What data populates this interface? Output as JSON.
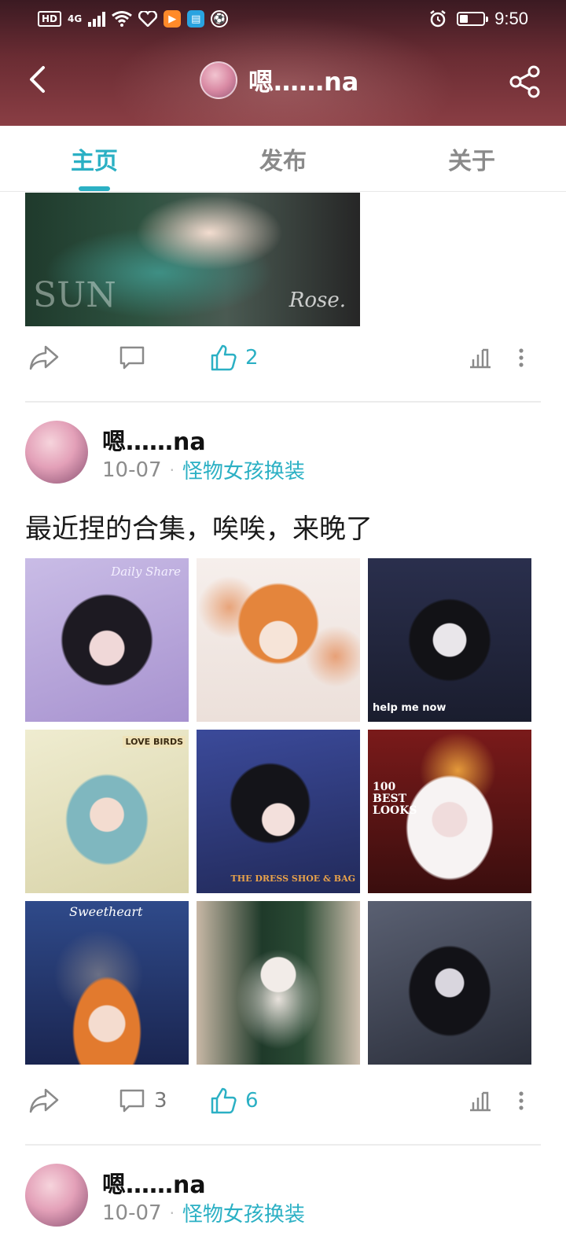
{
  "status_bar": {
    "network": "4G",
    "hd_label": "HD",
    "time": "9:50"
  },
  "header": {
    "profile_name": "嗯……na"
  },
  "tabs": [
    {
      "label": "主页",
      "active": true
    },
    {
      "label": "发布",
      "active": false
    },
    {
      "label": "关于",
      "active": false
    }
  ],
  "top_post": {
    "image_texts": [
      "SUN",
      "Rose."
    ],
    "likes": "2"
  },
  "post": {
    "author": "嗯……na",
    "date": "10-07",
    "topic": "怪物女孩换装",
    "text": "最近捏的合集，唉唉，来晚了",
    "images": [
      {
        "caption": "Daily Share",
        "colors": [
          "#b7a6d8",
          "#2a1f2a"
        ]
      },
      {
        "caption": "",
        "colors": [
          "#f3e7e2",
          "#e59a6a"
        ]
      },
      {
        "caption": "help me now",
        "colors": [
          "#1e2236",
          "#cfd5e5"
        ]
      },
      {
        "caption": "LOVE BIRDS",
        "colors": [
          "#e9e6c6",
          "#6fa7b0"
        ]
      },
      {
        "caption": "THE DRESS SHOE & BAG",
        "colors": [
          "#2f3f85",
          "#121218"
        ]
      },
      {
        "caption": "100 BEST LOOKS",
        "colors": [
          "#6e1616",
          "#f0eaea"
        ]
      },
      {
        "caption": "Sweetheart",
        "colors": [
          "#2a3f7a",
          "#d8783a"
        ]
      },
      {
        "caption": "",
        "colors": [
          "#1f3a2a",
          "#d9cfc2"
        ]
      },
      {
        "caption": "",
        "colors": [
          "#2b2f3e",
          "#9aa2b5"
        ]
      }
    ],
    "comments": "3",
    "likes": "6"
  },
  "next_post": {
    "author": "嗯……na",
    "date": "10-07",
    "topic": "怪物女孩换装"
  },
  "colors": {
    "accent": "#2bb0c4",
    "header_bg": "#6a2c33"
  }
}
